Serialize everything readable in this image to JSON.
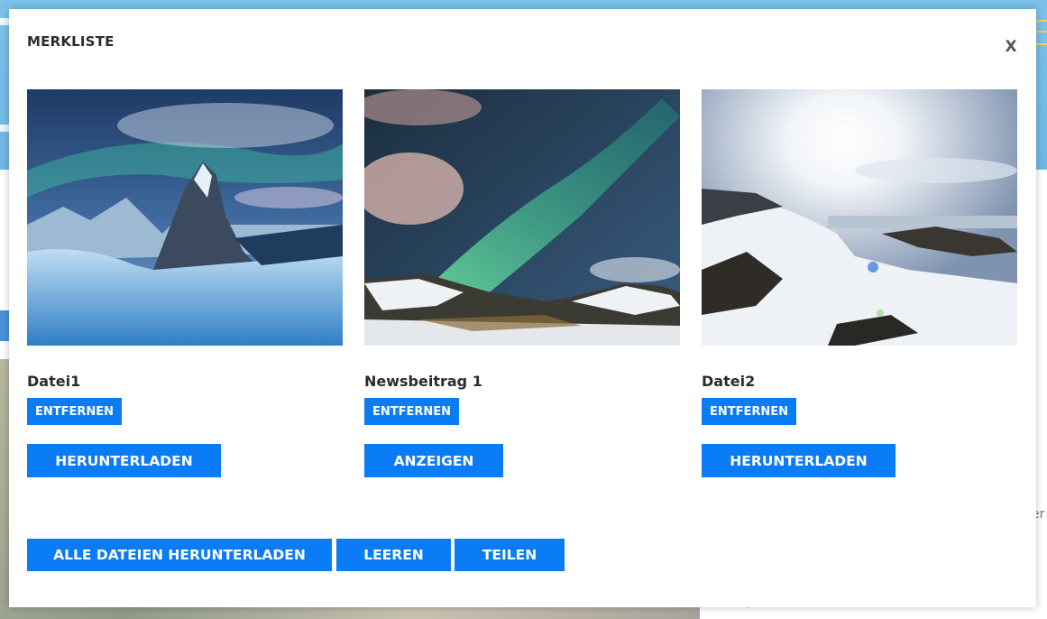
{
  "modal": {
    "title": "MERKLISTE",
    "close_label": "X"
  },
  "items": [
    {
      "title": "Datei1",
      "remove_label": "ENTFERNEN",
      "action_label": "HERUNTERLADEN",
      "image": "aurora-mountain-peak"
    },
    {
      "title": "Newsbeitrag 1",
      "remove_label": "ENTFERNEN",
      "action_label": "ANZEIGEN",
      "image": "green-aurora-snowy-hills"
    },
    {
      "title": "Datei2",
      "remove_label": "ENTFERNEN",
      "action_label": "HERUNTERLADEN",
      "image": "sunlit-snowy-coast"
    }
  ],
  "footer": {
    "download_all_label": "ALLE DATEIEN HERUNTERLADEN",
    "clear_label": "LEEREN",
    "share_label": "TEILEN"
  },
  "background": {
    "side_text": "er",
    "bottom_text": "y"
  },
  "colors": {
    "button_blue": "#0a7cf5",
    "header_blue": "#7cc1e8"
  }
}
